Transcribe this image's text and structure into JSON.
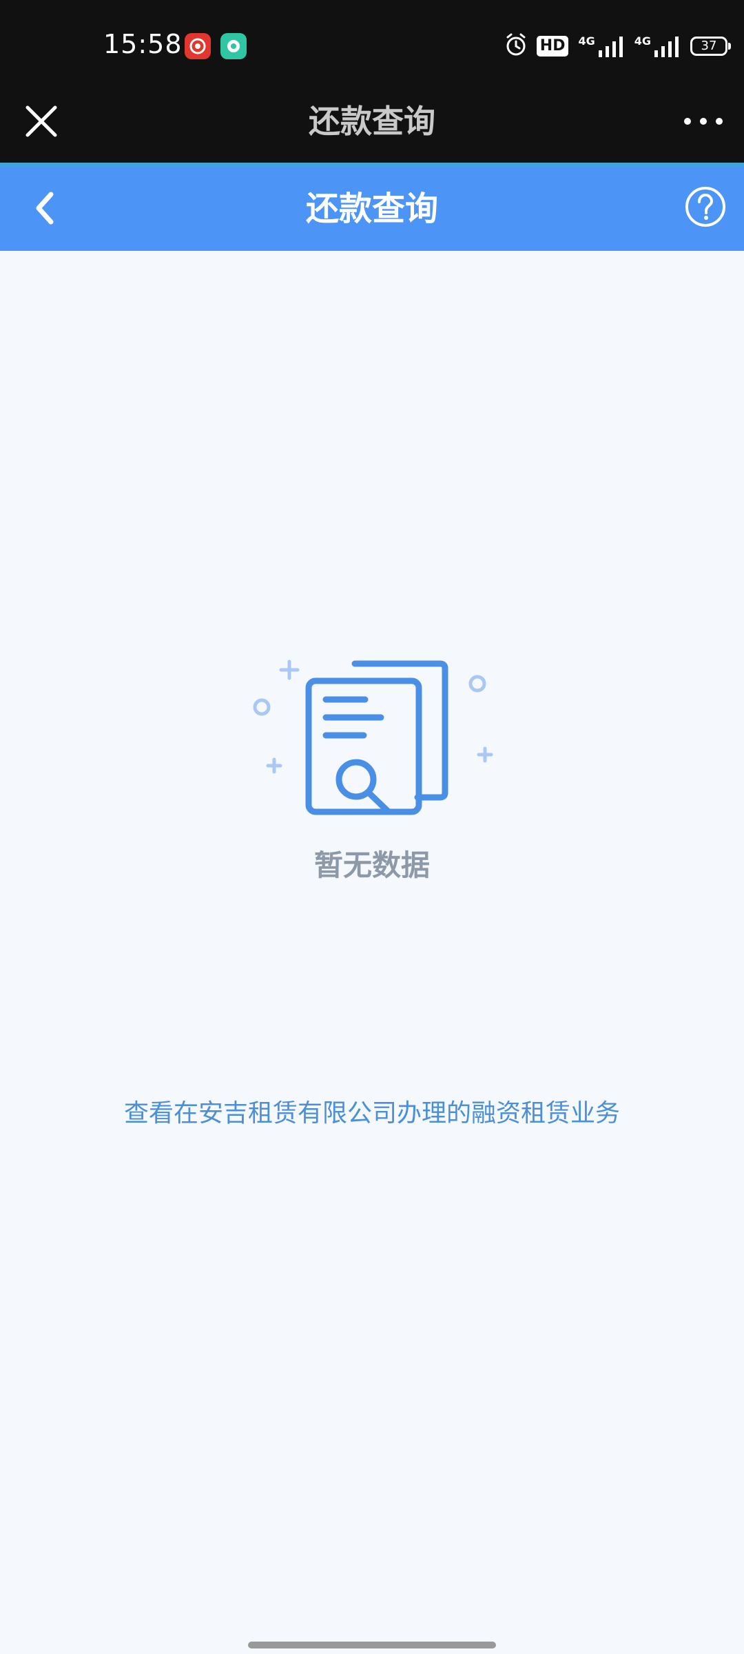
{
  "status_bar": {
    "time": "15:58",
    "hd_label": "HD",
    "net1_label": "4G",
    "net2_label": "4G",
    "battery": "37",
    "icons": [
      "app-notification-red-icon",
      "app-notification-green-icon",
      "alarm-icon",
      "signal-icon",
      "signal-icon",
      "battery-icon"
    ]
  },
  "title_bar": {
    "title": "还款查询",
    "close_icon": "close-icon",
    "more_icon": "more-icon"
  },
  "header": {
    "title": "还款查询",
    "back_icon": "chevron-left-icon",
    "help_icon": "help-icon"
  },
  "empty_state": {
    "icon": "document-search-icon",
    "text": "暂无数据"
  },
  "footer_link": {
    "text": "查看在安吉租赁有限公司办理的融资租赁业务"
  },
  "colors": {
    "status_bg": "#111111",
    "header_blue": "#4c94f5",
    "accent_line": "#3ea6d6",
    "page_bg": "#f5f8fc",
    "illustration_blue": "#4a8fe6",
    "link_blue": "#4a8fd8",
    "empty_text": "#8d99a8"
  }
}
